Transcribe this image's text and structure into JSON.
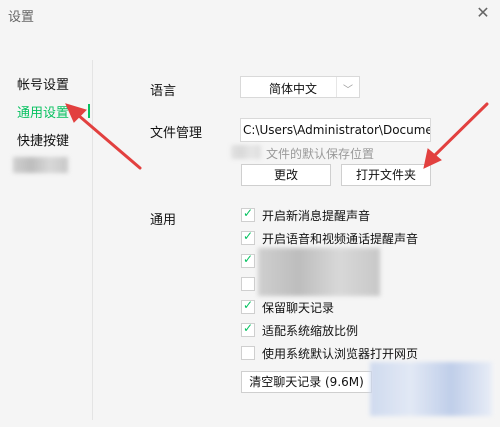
{
  "window": {
    "title": "设置"
  },
  "sidebar": {
    "items": [
      {
        "label": "帐号设置"
      },
      {
        "label": "通用设置"
      },
      {
        "label": "快捷按键"
      }
    ]
  },
  "language": {
    "label": "语言",
    "selected": "简体中文"
  },
  "file_mgmt": {
    "label": "文件管理",
    "path": "C:\\Users\\Administrator\\Documents",
    "hint": "文件的默认保存位置",
    "change_button": "更改",
    "open_folder_button": "打开文件夹"
  },
  "general": {
    "label": "通用",
    "options": [
      {
        "label": "开启新消息提醒声音",
        "checked": true
      },
      {
        "label": "开启语音和视频通话提醒声音",
        "checked": true
      },
      {
        "label": "",
        "checked": true
      },
      {
        "label": "",
        "checked": false
      },
      {
        "label": "保留聊天记录",
        "checked": true
      },
      {
        "label": "适配系统缩放比例",
        "checked": true
      },
      {
        "label": "使用系统默认浏览器打开网页",
        "checked": false
      }
    ],
    "clear_button": "清空聊天记录 (9.6M)"
  },
  "colors": {
    "accent": "#07c160",
    "arrow": "#e2403f"
  }
}
